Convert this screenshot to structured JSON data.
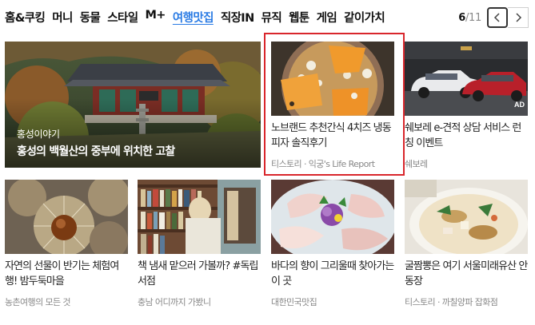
{
  "nav": {
    "tabs": [
      {
        "label": "홈&쿠킹",
        "active": false
      },
      {
        "label": "머니",
        "active": false
      },
      {
        "label": "동물",
        "active": false
      },
      {
        "label": "스타일",
        "active": false
      },
      {
        "label": "M+",
        "active": false
      },
      {
        "label": "여행맛집",
        "active": true
      },
      {
        "label": "직장IN",
        "active": false
      },
      {
        "label": "뮤직",
        "active": false
      },
      {
        "label": "웹툰",
        "active": false
      },
      {
        "label": "게임",
        "active": false
      },
      {
        "label": "같이가치",
        "active": false
      }
    ]
  },
  "pager": {
    "current": "6",
    "total": "/11"
  },
  "hero": {
    "subtitle": "홍성이야기",
    "title": "홍성의 백월산의 중부에 위치한 고찰"
  },
  "cards": [
    {
      "title": "노브랜드 추천간식 4치즈 냉동피자 솔직후기",
      "source": "티스토리 · 익궁's Life Report"
    },
    {
      "title": "쉐보레 e-견적 상담 서비스 런칭 이벤트",
      "source": "쉐보레",
      "badge": "AD"
    },
    {
      "title": "자연의 선물이 반기는 체험여행! 밤두둑마을",
      "source": "농촌여행의 모든 것"
    },
    {
      "title": "책 냄새 맡으러 가볼까? #독립서점",
      "source": "충남 어디까지 가봤니"
    },
    {
      "title": "바다의 향이 그리울때 찾아가는 이 곳",
      "source": "대한민국맛집"
    },
    {
      "title": "굴짬뽕은 여기 서울미래유산 안동장",
      "source": "티스토리 · 까칠양파 잡화점"
    }
  ]
}
